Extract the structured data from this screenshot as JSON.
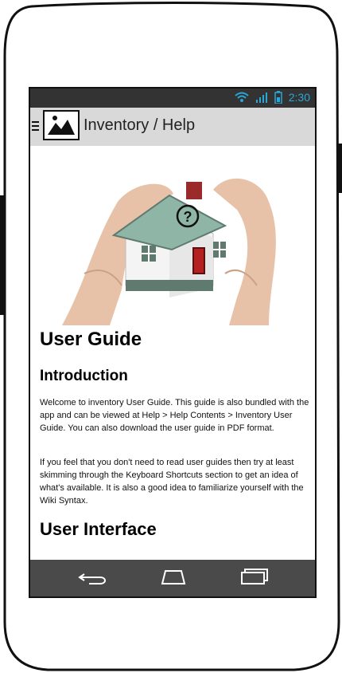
{
  "status": {
    "time": "2:30"
  },
  "actionbar": {
    "title": "Inventory / Help"
  },
  "content": {
    "heading_user_guide": "User Guide",
    "heading_intro": "Introduction",
    "paragraph_1": "Welcome to inventory User Guide. This guide is also bundled with the app and can be viewed at Help > Help Contents > Inventory User Guide. You can also download the user guide in PDF format.",
    "paragraph_2": "If you feel that you don't need to read user guides then try at least skimming through the Keyboard Shortcuts section to get an idea of what's available. It is also a good idea to familiarize yourself with the Wiki Syntax.",
    "heading_ui": "User Interface"
  },
  "icons": {
    "hamburger": "hamburger-icon",
    "app": "image-icon",
    "wifi": "wifi-icon",
    "signal": "signal-icon",
    "battery": "battery-icon",
    "back": "back-icon",
    "home": "home-icon",
    "recents": "recents-icon"
  }
}
